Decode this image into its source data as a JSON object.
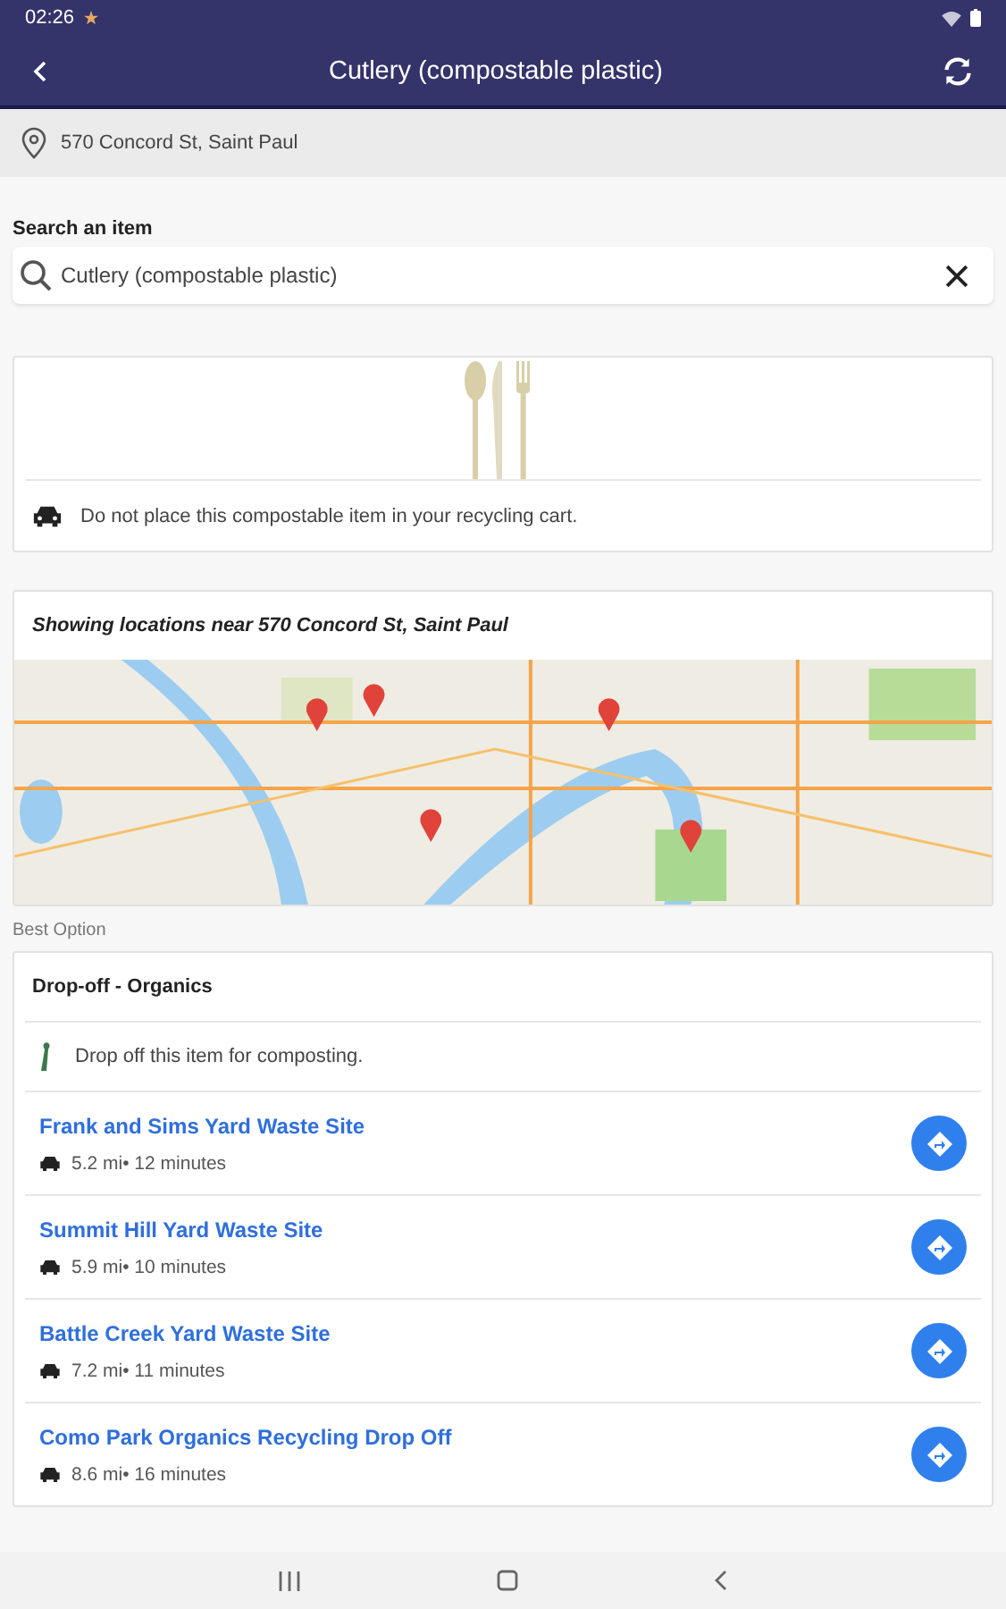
{
  "status_bar": {
    "time": "02:26"
  },
  "header": {
    "title": "Cutlery (compostable plastic)"
  },
  "address": "570 Concord St, Saint Paul",
  "search": {
    "label": "Search an item",
    "value": "Cutlery (compostable plastic)"
  },
  "item_card": {
    "note": "Do not place this compostable item in your recycling cart."
  },
  "map_card": {
    "title": "Showing locations near 570 Concord St, Saint Paul"
  },
  "best_option_label": "Best Option",
  "option_card": {
    "title": "Drop-off - Organics",
    "info": "Drop off this item for composting.",
    "locations": [
      {
        "name": "Frank and Sims Yard Waste Site",
        "distance": "5.2 mi• 12 minutes"
      },
      {
        "name": "Summit Hill Yard Waste Site",
        "distance": "5.9 mi• 10 minutes"
      },
      {
        "name": "Battle Creek Yard Waste Site",
        "distance": "7.2 mi• 11 minutes"
      },
      {
        "name": "Como Park Organics Recycling Drop Off",
        "distance": "8.6 mi• 16 minutes"
      }
    ]
  }
}
